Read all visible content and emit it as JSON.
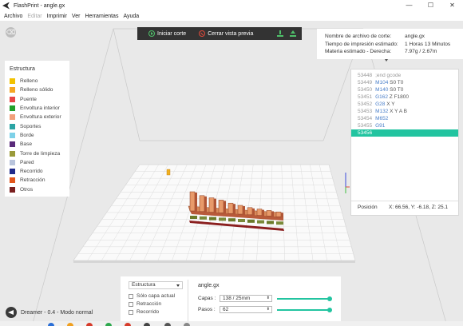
{
  "window": {
    "title": "FlashPrint - angle.gx",
    "controls": [
      "—",
      "☐",
      "✕"
    ]
  },
  "menu": {
    "items": [
      {
        "label": "Archivo",
        "enabled": true
      },
      {
        "label": "Editar",
        "enabled": false
      },
      {
        "label": "Imprimir",
        "enabled": true
      },
      {
        "label": "Ver",
        "enabled": true
      },
      {
        "label": "Herramientas",
        "enabled": true
      },
      {
        "label": "Ayuda",
        "enabled": true
      }
    ]
  },
  "toolbar": {
    "slice_label": "Iniciar corte",
    "close_preview_label": "Cerrar vista previa",
    "save_icon": "download-icon",
    "send_icon": "send-to-printer-icon"
  },
  "info": {
    "file_label": "Nombre de archivo de corte:",
    "file_value": "angle.gx",
    "time_label": "Tiempo de impresión estimado:",
    "time_value": "1 Horas 13 Minutos",
    "material_label": "Materia estimado - Derecha:",
    "material_value": "7.97g / 2.67m"
  },
  "legend": {
    "title": "Estructura",
    "items": [
      {
        "label": "Relleno",
        "color": "#f2c200"
      },
      {
        "label": "Relleno sólido",
        "color": "#f5a623"
      },
      {
        "label": "Puente",
        "color": "#e84545"
      },
      {
        "label": "Envoltura interior",
        "color": "#22a02a"
      },
      {
        "label": "Envoltura exterior",
        "color": "#f2a07a"
      },
      {
        "label": "Soportes",
        "color": "#2aa4a4"
      },
      {
        "label": "Borde",
        "color": "#7ed1e8"
      },
      {
        "label": "Base",
        "color": "#5a2a7a"
      },
      {
        "label": "Torre de limpieza",
        "color": "#9a9a3a"
      },
      {
        "label": "Pared",
        "color": "#b8c4dc"
      },
      {
        "label": "Recorrido",
        "color": "#1f2a8a"
      },
      {
        "label": "Retracción",
        "color": "#e2561c"
      },
      {
        "label": "Otros",
        "color": "#7a1f1f"
      }
    ]
  },
  "gcode": {
    "lines": [
      {
        "num": "53448",
        "cmd": "",
        "rest": ";end gcode",
        "selected": false
      },
      {
        "num": "53449",
        "cmd": "M104",
        "rest": "S0 T0",
        "selected": false
      },
      {
        "num": "53450",
        "cmd": "M140",
        "rest": "S0 T0",
        "selected": false
      },
      {
        "num": "53451",
        "cmd": "G162",
        "rest": "Z F1800",
        "selected": false
      },
      {
        "num": "53452",
        "cmd": "G28",
        "rest": "X Y",
        "selected": false
      },
      {
        "num": "53453",
        "cmd": "M132",
        "rest": "X Y A B",
        "selected": false
      },
      {
        "num": "53454",
        "cmd": "M652",
        "rest": "",
        "selected": false
      },
      {
        "num": "53455",
        "cmd": "G91",
        "rest": "",
        "selected": false
      },
      {
        "num": "53456",
        "cmd": "",
        "rest": "",
        "selected": true
      }
    ],
    "position_label": "Posición",
    "position_value": "X: 66.56, Y: -6.18, Z: 25.1"
  },
  "bottom": {
    "view_select": "Estructura",
    "checkbox_current_layer": "Sólo capa actual",
    "checkbox_retraction": "Retracción",
    "checkbox_travel": "Recorrido",
    "file_name": "angle.gx",
    "layers_label": "Capas :",
    "layers_value": "138 / 25mm",
    "layers_fraction": 1.0,
    "steps_label": "Pasos :",
    "steps_value": "62",
    "steps_fraction": 1.0
  },
  "status": {
    "machine": "Dreamer - 0.4 - Modo normal"
  }
}
